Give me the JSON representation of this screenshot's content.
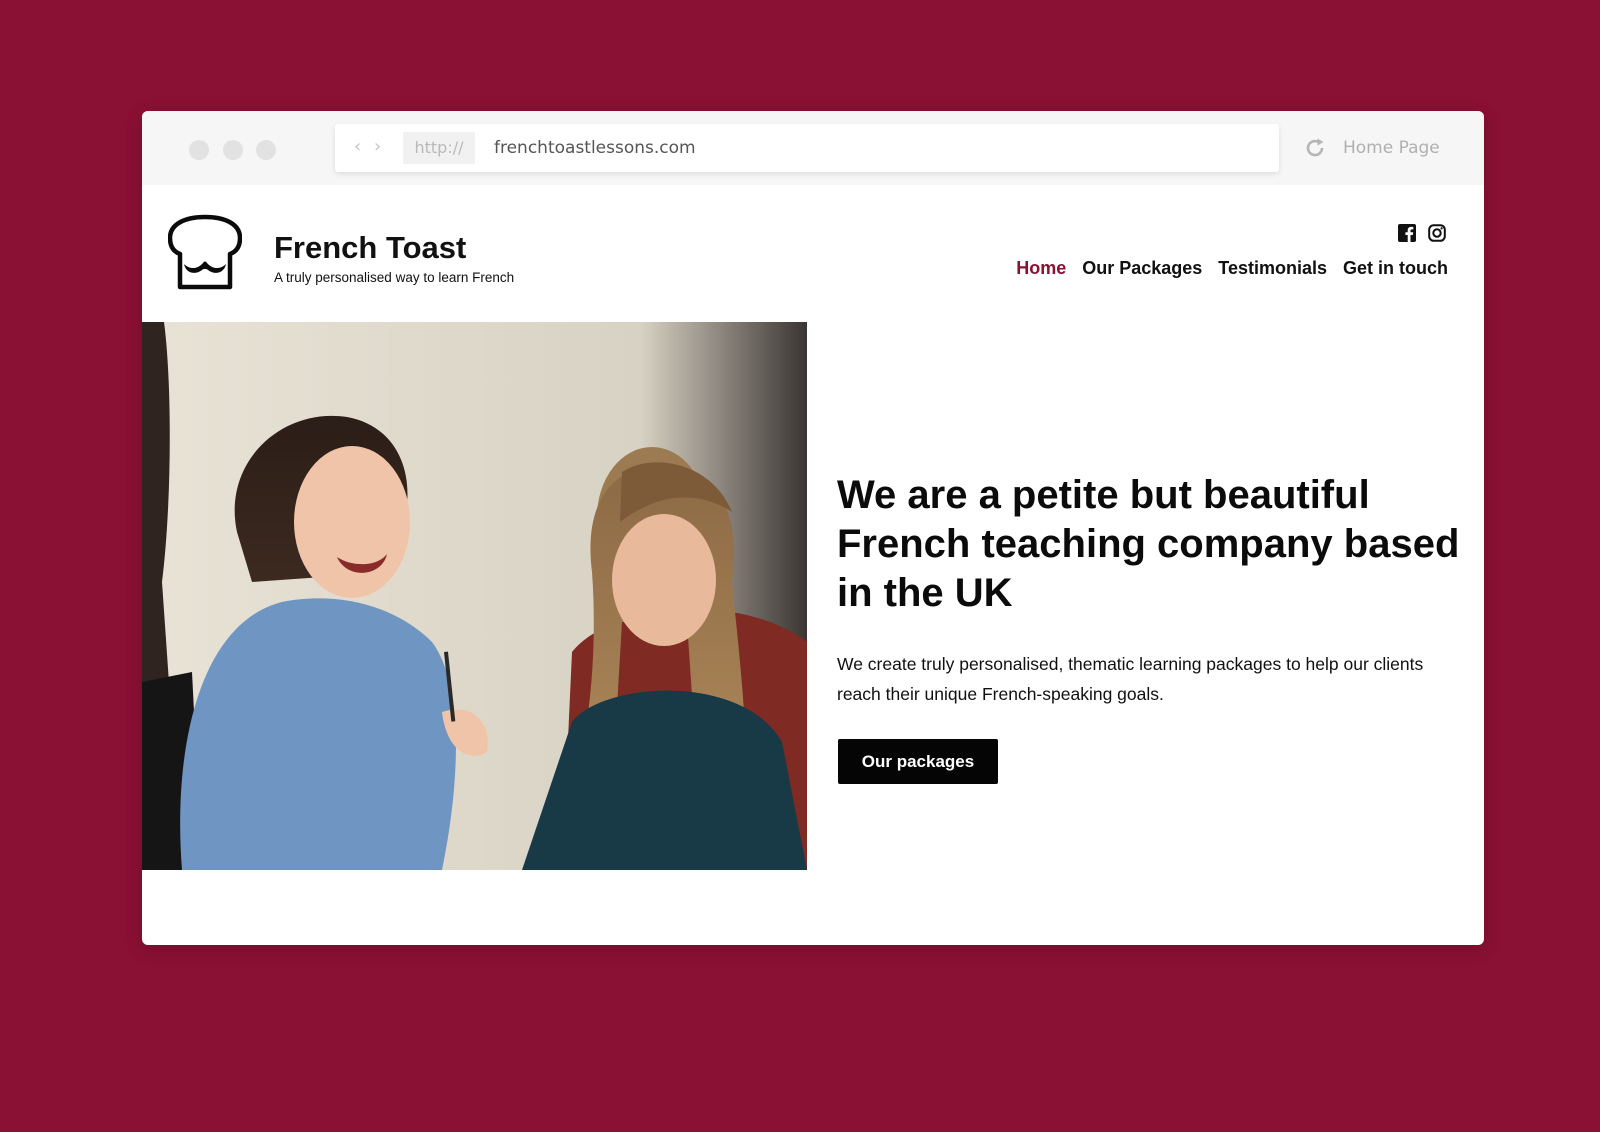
{
  "browser": {
    "protocol": "http://",
    "url": "frenchtoastlessons.com",
    "home_label": "Home Page",
    "icons": [
      "window-dot",
      "back-arrow-icon",
      "forward-arrow-icon",
      "reload-icon"
    ]
  },
  "site": {
    "brand_title": "French Toast",
    "brand_subtitle": "A truly personalised way to learn French",
    "logo_icon": "toast-mustache-logo",
    "social_icons": [
      "facebook-icon",
      "instagram-icon"
    ],
    "nav": [
      {
        "label": "Home",
        "active": true
      },
      {
        "label": "Our Packages",
        "active": false
      },
      {
        "label": "Testimonials",
        "active": false
      },
      {
        "label": "Get in touch",
        "active": false
      }
    ]
  },
  "hero": {
    "title": "We are a petite but beautiful French teaching company based in the UK",
    "text": "We create truly personalised, thematic learning packages to help our clients reach their unique French-speaking goals.",
    "cta_label": "Our packages"
  },
  "colors": {
    "brand": "#8a1034",
    "button": "#050505",
    "text": "#111111"
  }
}
